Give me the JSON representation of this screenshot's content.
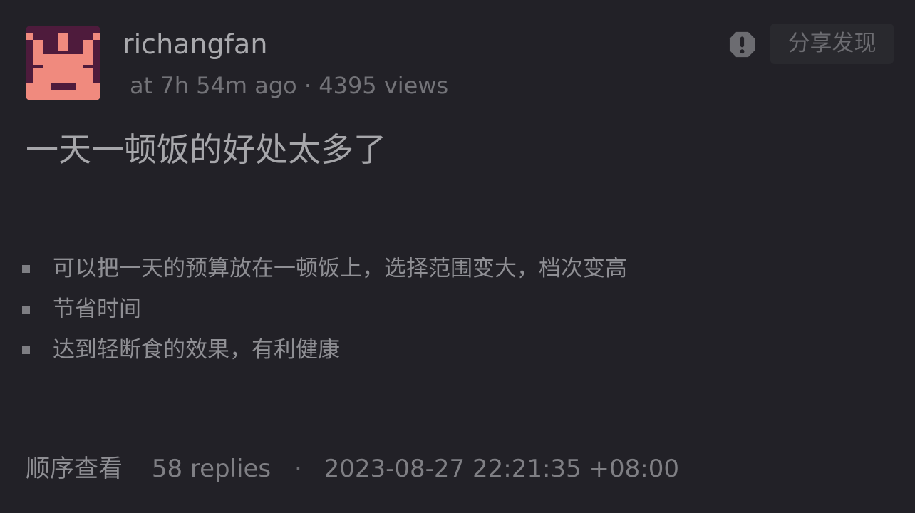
{
  "post": {
    "username": "richangfan",
    "meta": "at 7h 54m ago · 4395 views",
    "title": "一天一顿饭的好处太多了",
    "bullets": [
      "可以把一天的预算放在一顿饭上，选择范围变大，档次变高",
      "节省时间",
      "达到轻断食的效果，有利健康"
    ]
  },
  "actions": {
    "report_icon": "exclamation-circle-icon",
    "share_label": "分享发现"
  },
  "footer": {
    "order_label": "顺序查看",
    "replies": "58 replies",
    "separator": "·",
    "datetime": "2023-08-27 22:21:35 +08:00"
  },
  "avatar": {
    "colors": {
      "background": "#4e1b3c",
      "foreground": "#f08a7e"
    }
  }
}
